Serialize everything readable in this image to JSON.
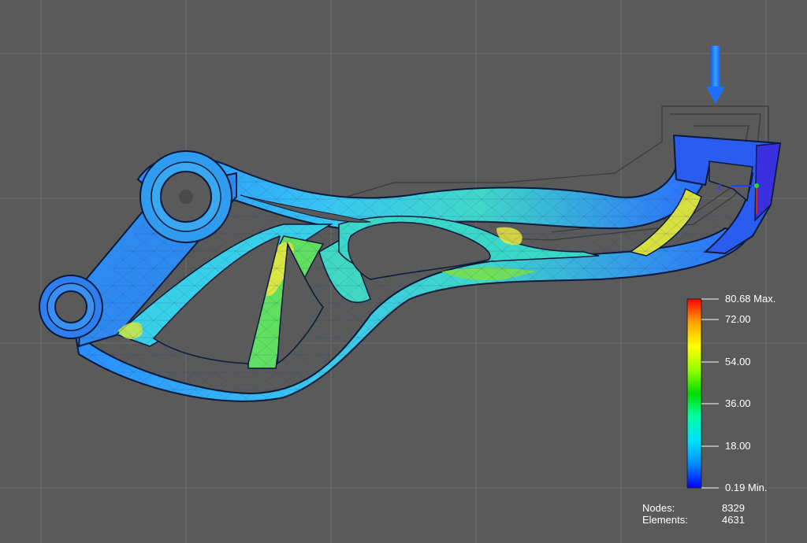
{
  "legend": {
    "max_label": "80.68 Max.",
    "min_label": "0.19 Min.",
    "ticks": [
      "72.00",
      "54.00",
      "36.00",
      "18.00"
    ],
    "colors": [
      "#ff0000",
      "#ffb000",
      "#ffff00",
      "#8cff00",
      "#00e000",
      "#00ffa0",
      "#00e0ff",
      "#0080ff",
      "#0000ff"
    ]
  },
  "stats": {
    "nodes_label": "Nodes:",
    "nodes_value": "8329",
    "elements_label": "Elements:",
    "elements_value": "4631"
  },
  "triad": {
    "z_label": "Z"
  },
  "colors": {
    "background": "#5a5a5a",
    "grid": "#6e6e6e",
    "load_arrow": "#1e6fff",
    "part_base": "#28b4e6"
  }
}
